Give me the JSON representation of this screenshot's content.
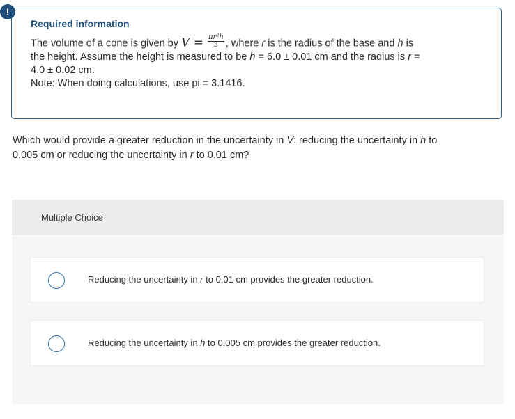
{
  "badge": {
    "symbol": "!"
  },
  "info": {
    "title": "Required information",
    "line1_pre": "The volume of a cone is given by",
    "formula_lhs": "V =",
    "formula_num": "πr²h",
    "formula_den": "3",
    "line1_post_a": ", where ",
    "var_r": "r",
    "line1_post_b": " is the radius of the base and ",
    "var_h": "h",
    "line1_post_c": " is",
    "line2_pre": "the height. Assume the height is measured to be ",
    "line2_mid": " = 6.0 ± 0.01 cm and the radius is ",
    "line2_end": " =",
    "line3": "4.0 ± 0.02 cm.",
    "line4": "Note: When doing calculations, use pi = 3.1416."
  },
  "question": {
    "part1": "Which would provide a greater reduction in the uncertainty in ",
    "var_V": "V",
    "part2": ": reducing the uncertainty in ",
    "var_h": "h",
    "part3": " to",
    "part4": "0.005 cm or reducing the uncertainty in ",
    "var_r": "r",
    "part5": " to 0.01 cm?"
  },
  "multiple_choice": {
    "label": "Multiple Choice",
    "options": [
      {
        "pre": "Reducing the uncertainty in ",
        "var": "r",
        "post": " to 0.01 cm provides the greater reduction.",
        "selected": false
      },
      {
        "pre": "Reducing the uncertainty in ",
        "var": "h",
        "post": " to 0.005 cm provides the greater reduction.",
        "selected": false
      }
    ]
  },
  "colors": {
    "accent": "#1f4f7a",
    "border": "#2e5c8a",
    "radio": "#2e6da4",
    "panel_bg": "#f6f6f6",
    "panel_header_bg": "#ececec"
  }
}
